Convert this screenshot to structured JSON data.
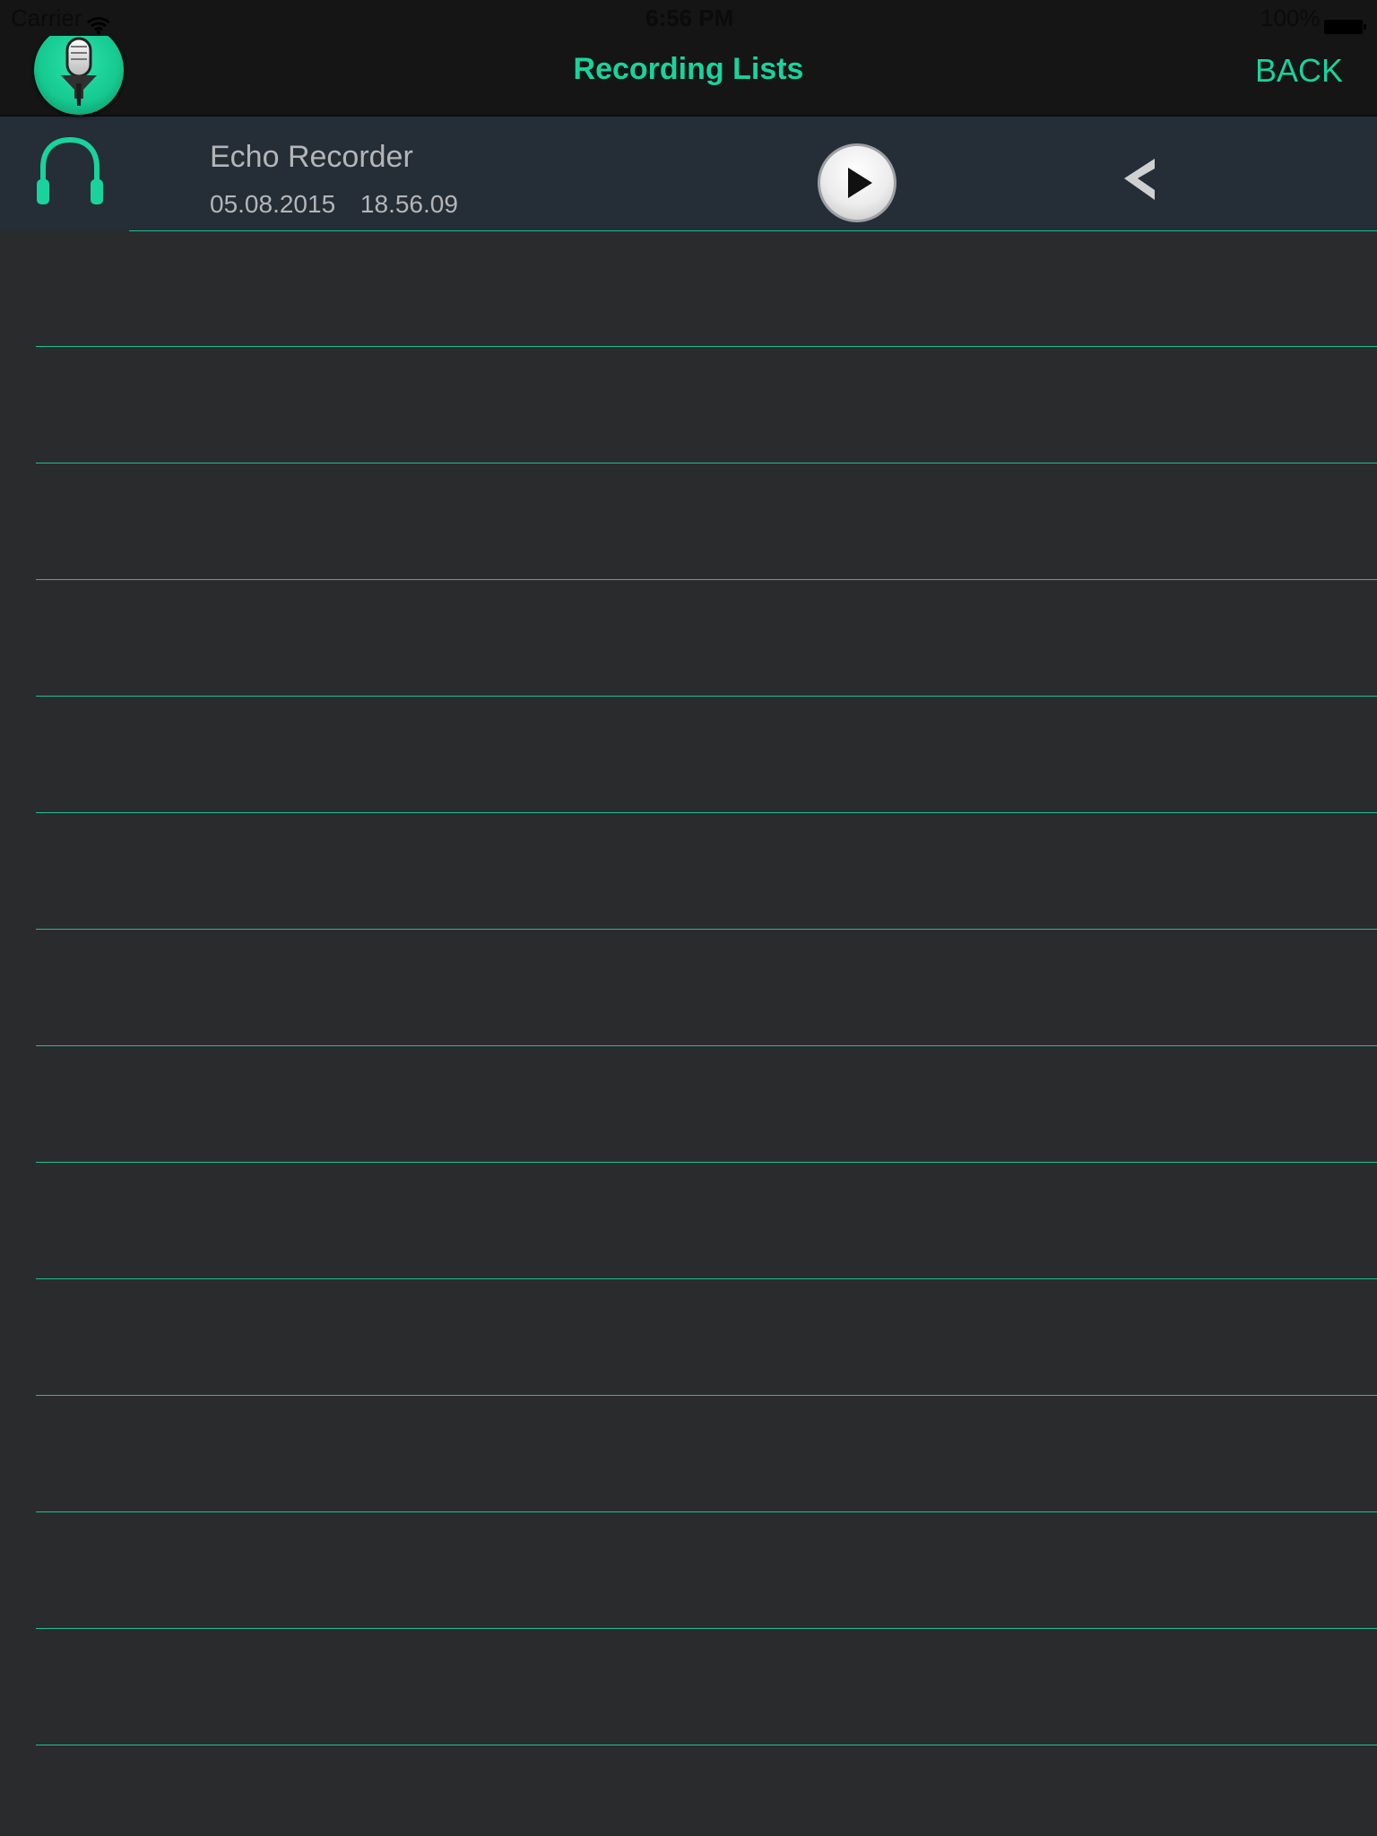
{
  "status_bar": {
    "carrier": "Carrier",
    "time": "6:56 PM",
    "battery": "100%"
  },
  "nav": {
    "title": "Recording Lists",
    "back_label": "BACK"
  },
  "recordings": [
    {
      "title": "Echo Recorder",
      "date": "05.08.2015",
      "time": "18.56.09"
    }
  ],
  "colors": {
    "accent": "#19d39c",
    "background": "#2a2b2d",
    "nav_background": "#151515",
    "selected_row": "#252d37",
    "text_muted": "#b4b5b7",
    "separator": "#1fbf92"
  },
  "icons": {
    "logo": "microphone-logo-icon",
    "wifi": "wifi-icon",
    "battery": "battery-icon",
    "headphones": "headphones-icon",
    "play": "play-icon",
    "chevron": "chevron-left-icon"
  }
}
